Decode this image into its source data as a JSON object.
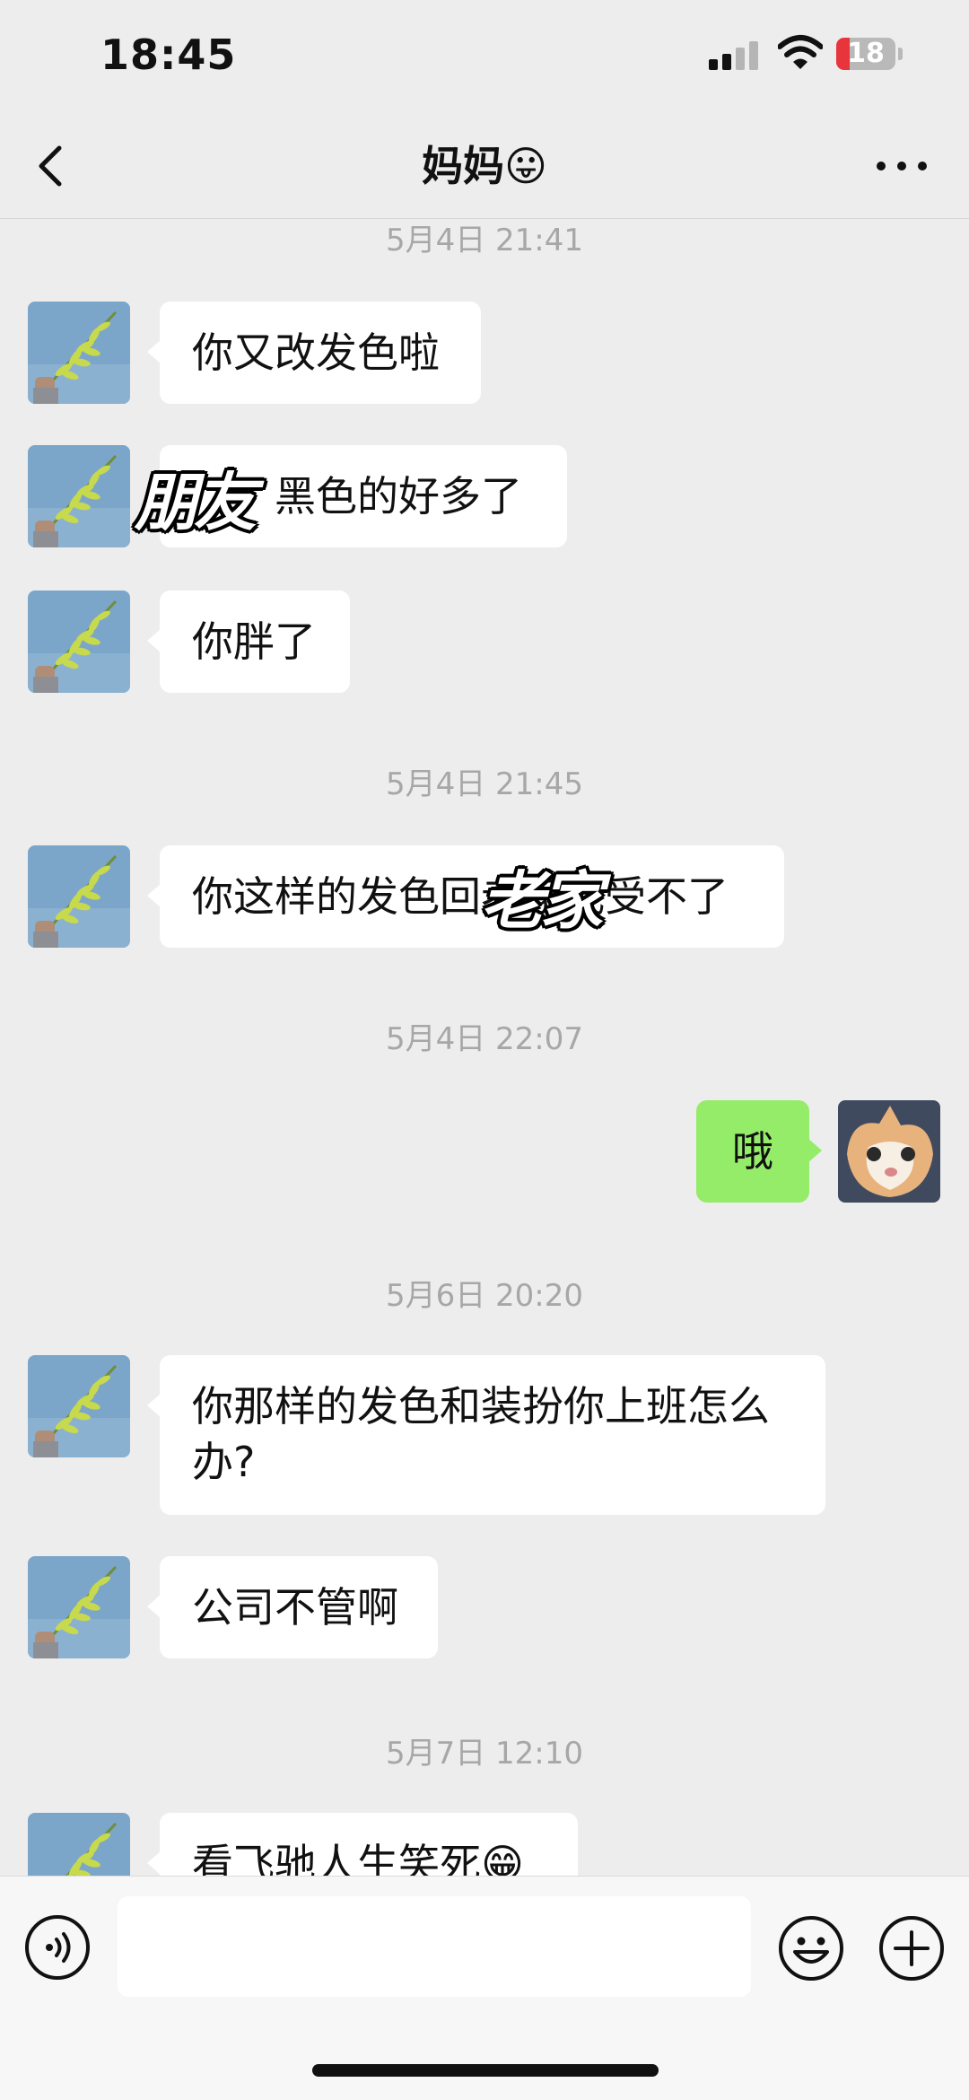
{
  "status_bar": {
    "time": "18:45",
    "battery_level": "18"
  },
  "nav": {
    "title": "妈妈😛",
    "back_icon": "chevron-left-icon",
    "more_icon": "more-dots-icon"
  },
  "messages": [
    {
      "type": "timestamp",
      "text": "5月4日 21:41"
    },
    {
      "type": "received",
      "text": "你又改发色啦"
    },
    {
      "type": "received",
      "text": "黑色的好多了"
    },
    {
      "type": "received",
      "text": "你胖了"
    },
    {
      "type": "timestamp",
      "text": "5月4日 21:45"
    },
    {
      "type": "received",
      "text": "你这样的发色回老家我受不了"
    },
    {
      "type": "timestamp",
      "text": "5月4日 22:07"
    },
    {
      "type": "sent",
      "text": "哦"
    },
    {
      "type": "timestamp",
      "text": "5月6日 20:20"
    },
    {
      "type": "received",
      "text": "你那样的发色和装扮你上班怎么办?"
    },
    {
      "type": "received",
      "text": "公司不管啊"
    },
    {
      "type": "timestamp",
      "text": "5月7日 12:10"
    },
    {
      "type": "received",
      "text": "看飞驰人生笑死😁"
    }
  ],
  "overlays": {
    "first": "朋友",
    "second": "老家"
  },
  "input_bar": {
    "voice_icon": "voice-icon",
    "emoji_icon": "emoji-icon",
    "plus_icon": "plus-icon"
  },
  "colors": {
    "background": "#ededed",
    "sent_bubble": "#95ec69",
    "received_bubble": "#ffffff",
    "timestamp": "#a7a7a7"
  }
}
